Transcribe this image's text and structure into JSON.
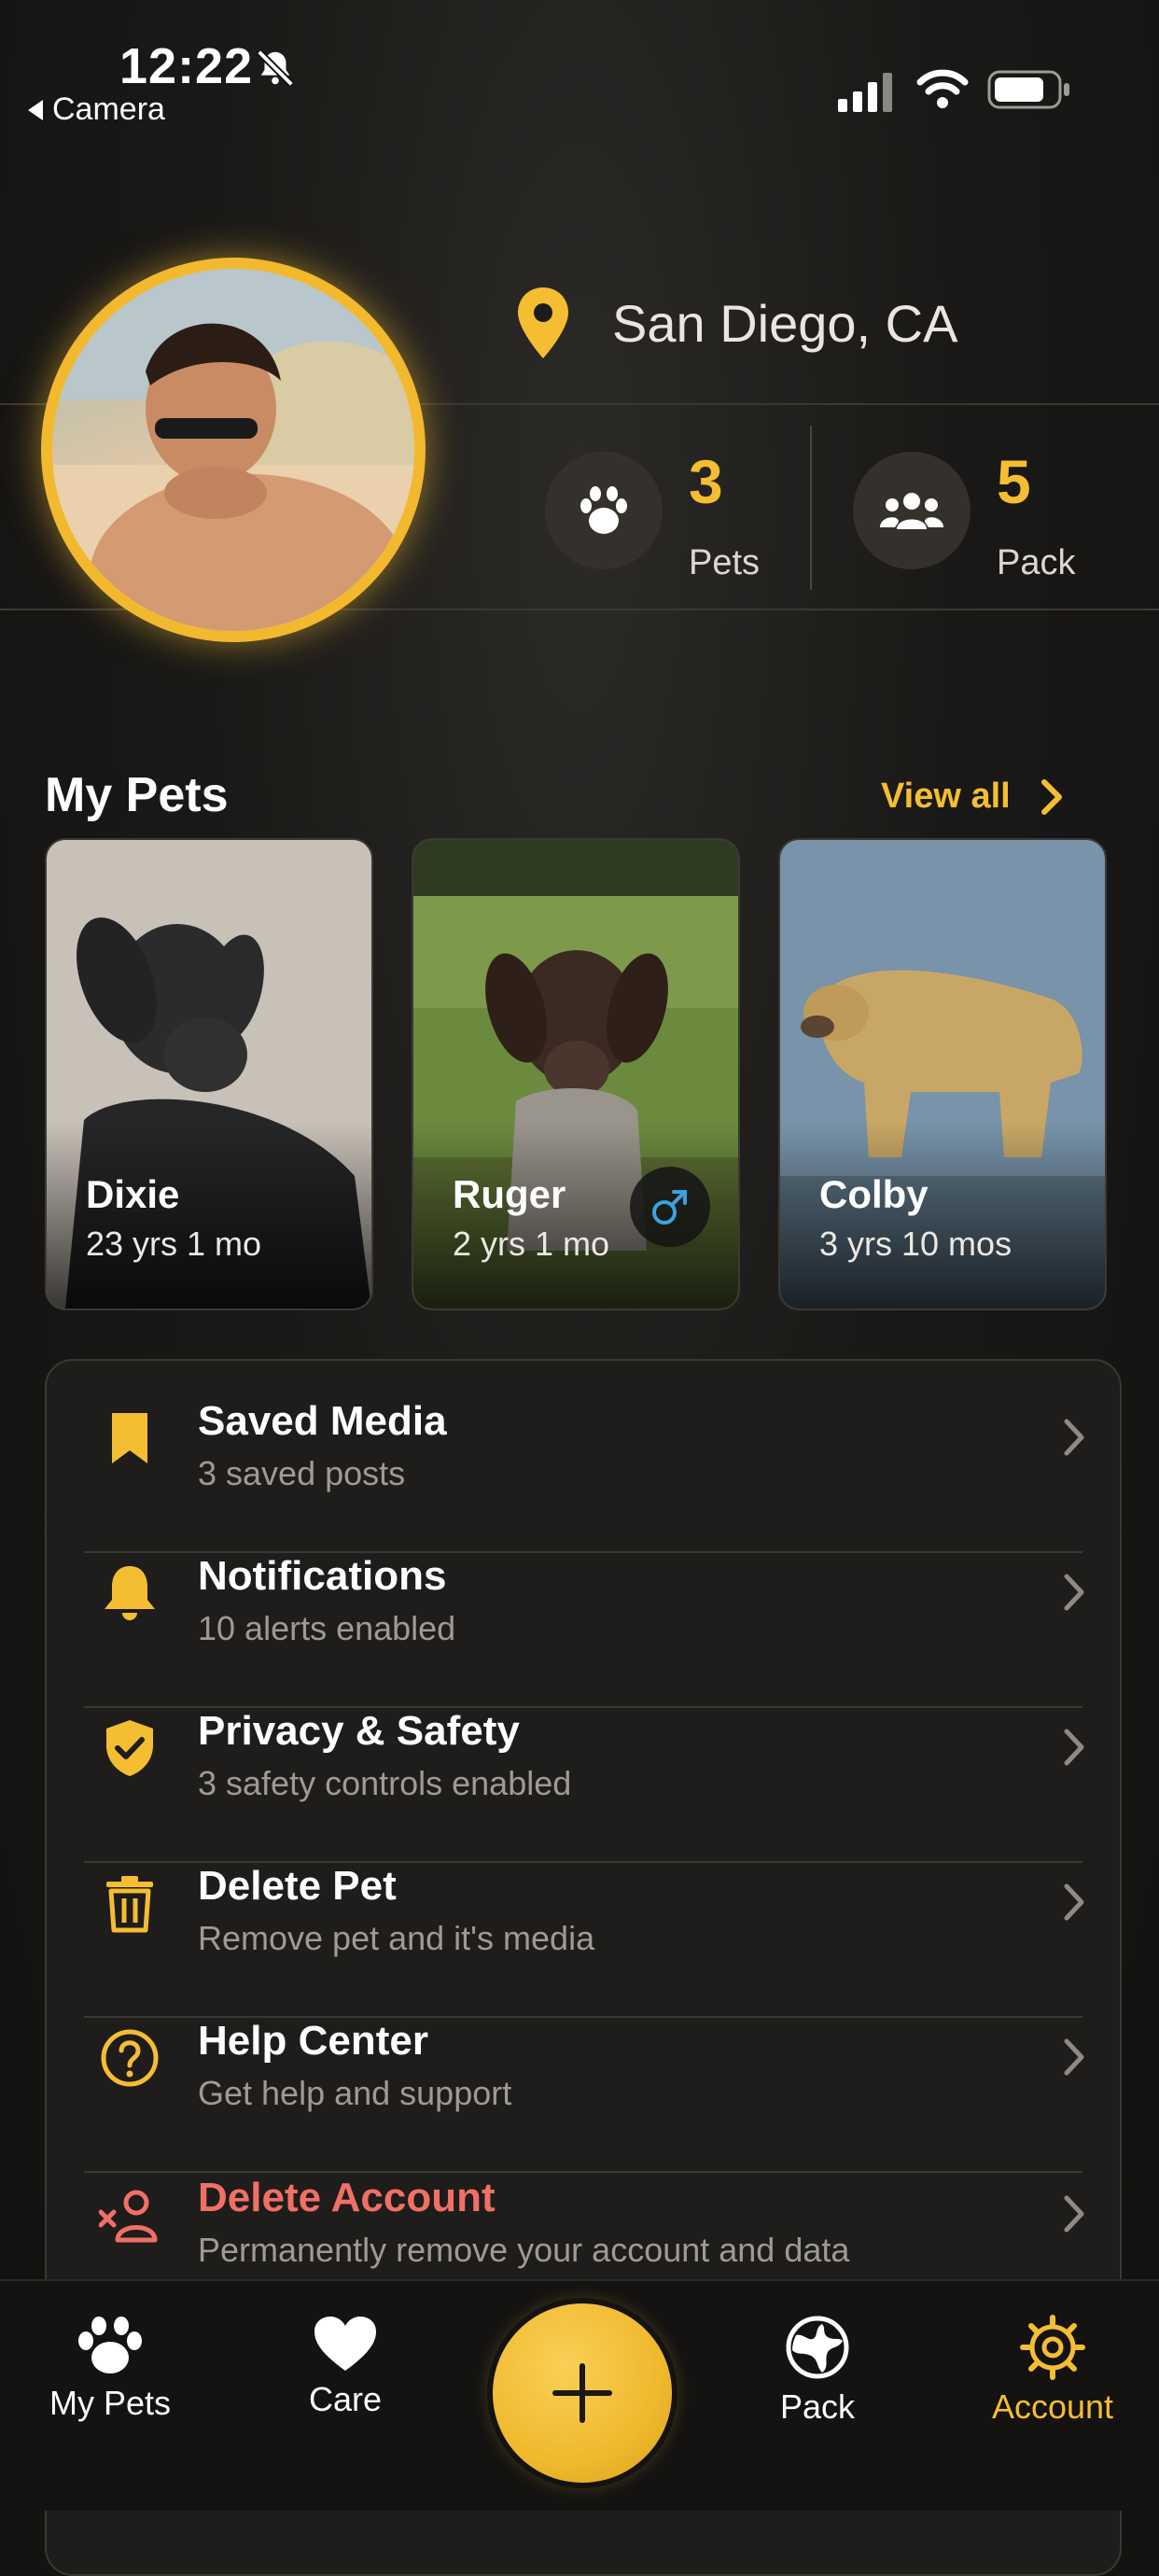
{
  "status_bar": {
    "time": "12:22",
    "back_label": "Camera"
  },
  "profile": {
    "location": "San Diego, CA",
    "stats": [
      {
        "value": "3",
        "label": "Pets",
        "icon": "paw-icon"
      },
      {
        "value": "5",
        "label": "Pack",
        "icon": "group-icon"
      }
    ]
  },
  "my_pets": {
    "title": "My Pets",
    "view_all": "View all",
    "pets": [
      {
        "name": "Dixie",
        "age": "23 yrs 1 mo"
      },
      {
        "name": "Ruger",
        "age": "2 yrs 1 mo",
        "gender": "male"
      },
      {
        "name": "Colby",
        "age": "3 yrs 10 mos"
      }
    ]
  },
  "settings": [
    {
      "title": "Saved Media",
      "subtitle": "3 saved posts",
      "icon": "bookmark-icon"
    },
    {
      "title": "Notifications",
      "subtitle": "10 alerts enabled",
      "icon": "bell-icon"
    },
    {
      "title": "Privacy & Safety",
      "subtitle": "3 safety controls enabled",
      "icon": "shield-check-icon"
    },
    {
      "title": "Delete Pet",
      "subtitle": "Remove pet and it's media",
      "icon": "trash-icon"
    },
    {
      "title": "Help Center",
      "subtitle": "Get help and support",
      "icon": "help-circle-icon"
    },
    {
      "title": "Delete Account",
      "subtitle": "Permanently remove your account and data",
      "icon": "remove-user-icon"
    }
  ],
  "tabbar": {
    "items": [
      {
        "label": "My Pets",
        "icon": "paw-icon"
      },
      {
        "label": "Care",
        "icon": "heart-icon"
      },
      {
        "label": "Pack",
        "icon": "globe-icon"
      },
      {
        "label": "Account",
        "icon": "gear-icon",
        "active": true
      }
    ]
  },
  "colors": {
    "accent": "#f5bd32",
    "danger": "#f07066",
    "background": "#141312"
  }
}
